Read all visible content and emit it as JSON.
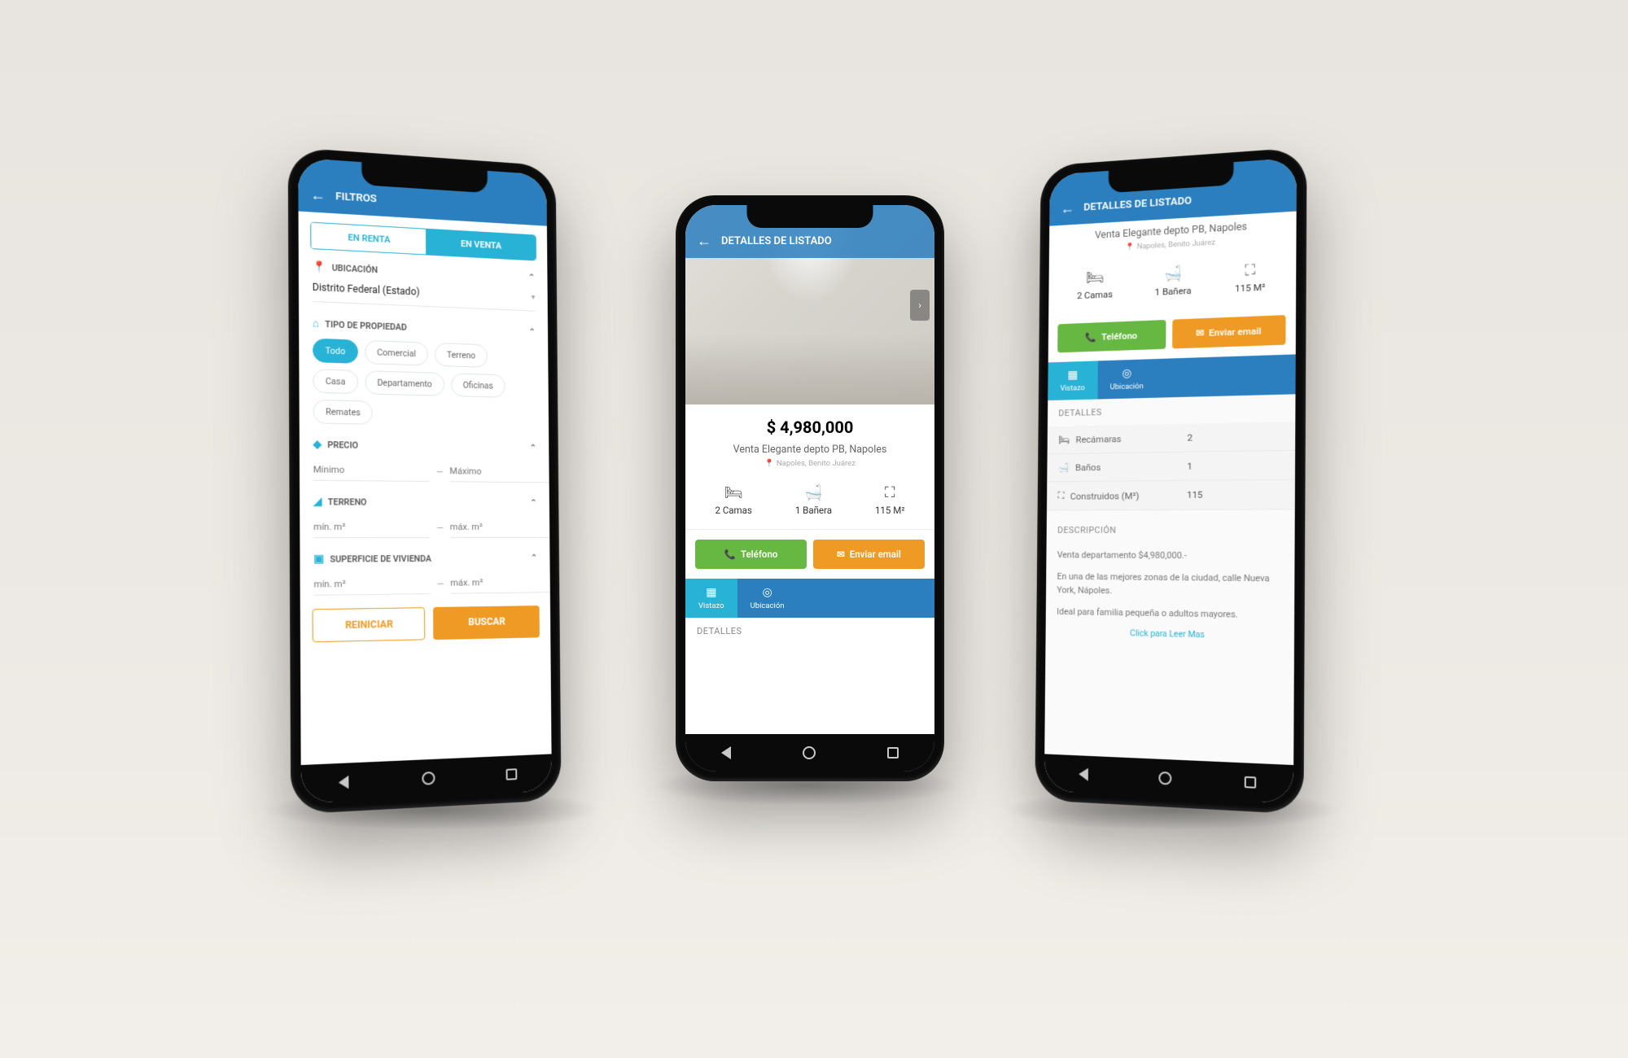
{
  "phone1": {
    "header": "FILTROS",
    "toggle": {
      "rent": "EN RENTA",
      "sale": "EN VENTA"
    },
    "ubicacion": {
      "label": "UBICACIÓN",
      "value": "Distrito Federal (Estado)"
    },
    "tipo": {
      "label": "TIPO DE PROPIEDAD",
      "chips": [
        "Todo",
        "Comercial",
        "Terreno",
        "Casa",
        "Departamento",
        "Oficinas",
        "Remates"
      ]
    },
    "precio": {
      "label": "PRECIO",
      "min": "Mínimo",
      "max": "Máximo"
    },
    "terreno": {
      "label": "TERRENO",
      "min": "mín. m²",
      "max": "máx. m²"
    },
    "superficie": {
      "label": "SUPERFICIE DE VIVIENDA",
      "min": "mín. m²",
      "max": "máx. m²"
    },
    "reset": "REINICIAR",
    "search": "BUSCAR"
  },
  "phone2": {
    "header": "DETALLES DE LISTADO",
    "price": "$ 4,980,000",
    "title": "Venta Elegante depto PB, Napoles",
    "subtitle": "Napoles, Benito Juárez",
    "stats": {
      "beds": "2 Camas",
      "baths": "1 Bañera",
      "area": "115 M²"
    },
    "cta": {
      "phone": "Teléfono",
      "email": "Enviar email"
    },
    "tabs": {
      "vistazo": "Vistazo",
      "ubicacion": "Ubicación"
    },
    "detalles": "DETALLES"
  },
  "phone3": {
    "header": "DETALLES DE LISTADO",
    "title": "Venta Elegante depto PB, Napoles",
    "subtitle": "Napoles, Benito Juárez",
    "stats": {
      "beds": "2 Camas",
      "baths": "1 Bañera",
      "area": "115 M²"
    },
    "cta": {
      "phone": "Teléfono",
      "email": "Enviar email"
    },
    "tabs": {
      "vistazo": "Vistazo",
      "ubicacion": "Ubicación"
    },
    "detallesLabel": "DETALLES",
    "rows": {
      "recamaras": {
        "k": "Recámaras",
        "v": "2"
      },
      "banos": {
        "k": "Baños",
        "v": "1"
      },
      "construidos": {
        "k": "Construidos (M²)",
        "v": "115"
      }
    },
    "descLabel": "DESCRIPCIÓN",
    "desc1": "Venta departamento $4,980,000.-",
    "desc2": "En una de las mejores zonas de la ciudad, calle Nueva York, Nápoles.",
    "desc3": "Ideal para familia pequeña o adultos mayores.",
    "readmore": "Click para Leer Mas"
  }
}
